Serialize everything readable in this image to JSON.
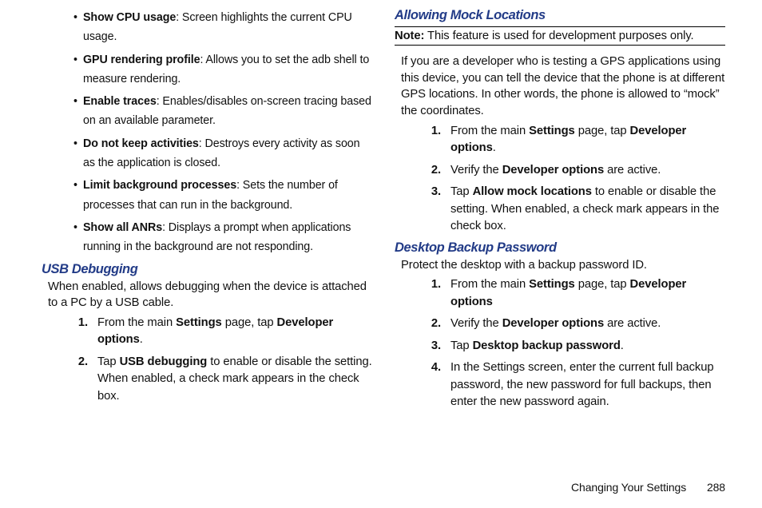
{
  "left": {
    "bullets": [
      {
        "term": "Show CPU usage",
        "desc": ": Screen highlights the current CPU usage."
      },
      {
        "term": "GPU rendering profile",
        "desc": ": Allows you to set the adb shell to measure rendering."
      },
      {
        "term": "Enable traces",
        "desc": ": Enables/disables on-screen tracing based on an available parameter."
      },
      {
        "term": "Do not keep activities",
        "desc": ": Destroys every activity as soon as the application is closed."
      },
      {
        "term": "Limit background processes",
        "desc": ": Sets the number of processes that can run in the background."
      },
      {
        "term": "Show all ANRs",
        "desc": ": Displays a prompt when applications running in the background are not responding."
      }
    ],
    "usb": {
      "heading": "USB Debugging",
      "intro": "When enabled, allows debugging when the device is attached to a PC by a USB cable.",
      "step1": {
        "pre": "From the main ",
        "b1": "Settings",
        "mid": " page, tap ",
        "b2": "Developer options",
        "post": "."
      },
      "step2": {
        "pre": "Tap ",
        "b1": "USB debugging",
        "post": " to enable or disable the setting. When enabled, a check mark appears in the check box."
      }
    }
  },
  "right": {
    "mock": {
      "heading": "Allowing Mock Locations",
      "note_label": "Note:",
      "note_text": " This feature is used for development purposes only.",
      "intro": "If you are a developer who is testing a GPS applications using this device, you can tell the device that the phone is at different GPS locations. In other words, the phone is allowed to “mock” the coordinates.",
      "step1": {
        "pre": "From the main ",
        "b1": "Settings",
        "mid": " page, tap ",
        "b2": "Developer options",
        "post": "."
      },
      "step2": {
        "pre": "Verify the ",
        "b1": "Developer options",
        "post": " are active."
      },
      "step3": {
        "pre": "Tap ",
        "b1": "Allow mock locations",
        "post": " to enable or disable the setting. When enabled, a check mark appears in the check box."
      }
    },
    "desktop": {
      "heading": "Desktop Backup Password",
      "intro": "Protect the desktop with a backup password ID.",
      "step1": {
        "pre": "From the main ",
        "b1": "Settings",
        "mid": " page, tap ",
        "b2": "Developer options",
        "post": ""
      },
      "step2": {
        "pre": "Verify the ",
        "b1": "Developer options",
        "post": " are active."
      },
      "step3": {
        "pre": "Tap ",
        "b1": "Desktop backup password",
        "post": "."
      },
      "step4": "In the Settings screen, enter the current full backup password, the new password for full backups, then enter the new password again."
    }
  },
  "footer": {
    "section": "Changing Your Settings",
    "page": "288"
  }
}
